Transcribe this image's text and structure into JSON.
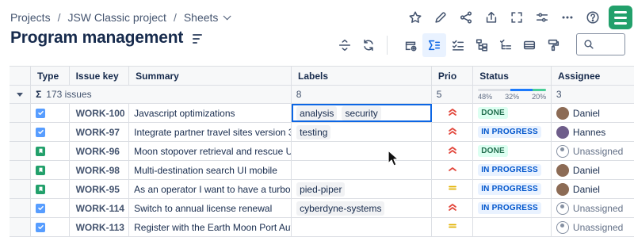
{
  "breadcrumb": {
    "items": [
      "Projects",
      "JSW Classic project",
      "Sheets"
    ],
    "separator": "/"
  },
  "page": {
    "title": "Program management"
  },
  "top_actions": [
    "star-icon",
    "edit-icon",
    "share-icon",
    "export-icon",
    "fullscreen-icon",
    "filter-settings-icon",
    "more-icon",
    "help-icon"
  ],
  "toolbar": [
    "expand-rows-icon",
    "refresh-icon",
    "add-view-icon",
    "sum-icon",
    "checklist-icon",
    "hierarchy-icon",
    "hierarchy-check-icon",
    "card-icon",
    "format-paint-icon"
  ],
  "search": {
    "placeholder": ""
  },
  "table": {
    "columns": [
      "Type",
      "Issue key",
      "Summary",
      "Labels",
      "Prio",
      "Status",
      "Assignee"
    ],
    "summary": {
      "issues": "173 issues",
      "labels": "8",
      "prio": "5",
      "status_segments": [
        {
          "label": "48%",
          "value": 48,
          "color": "#dcdfe4"
        },
        {
          "label": "32%",
          "value": 32,
          "color": "#1d7afc"
        },
        {
          "label": "20%",
          "value": 20,
          "color": "#4bce97"
        }
      ],
      "assignee": "3"
    },
    "rows": [
      {
        "type": "task",
        "key": "WORK-100",
        "summary": "Javascript optimizations",
        "labels": [
          "analysis",
          "security"
        ],
        "prio": "highest",
        "status": "DONE",
        "status_kind": "done",
        "assignee": "Daniel",
        "avatar": "person"
      },
      {
        "type": "task",
        "key": "WORK-97",
        "summary": "Integrate partner travel sites version 3",
        "labels": [
          "testing"
        ],
        "prio": "highest",
        "status": "IN PROGRESS",
        "status_kind": "prog",
        "assignee": "Hannes",
        "avatar": "person2"
      },
      {
        "type": "story",
        "key": "WORK-96",
        "summary": "Moon stopover retrieval and rescue UI mobile",
        "labels": [],
        "prio": "highest",
        "status": "DONE",
        "status_kind": "done",
        "assignee": "Unassigned",
        "avatar": "unassigned"
      },
      {
        "type": "story",
        "key": "WORK-98",
        "summary": "Multi-destination search UI mobile",
        "labels": [],
        "prio": "high",
        "status": "IN PROGRESS",
        "status_kind": "prog",
        "assignee": "Daniel",
        "avatar": "person"
      },
      {
        "type": "story",
        "key": "WORK-95",
        "summary": "As an operator I want to have a turbo boost",
        "labels": [
          "pied-piper"
        ],
        "prio": "medium",
        "status": "IN PROGRESS",
        "status_kind": "prog",
        "assignee": "Daniel",
        "avatar": "person"
      },
      {
        "type": "task",
        "key": "WORK-114",
        "summary": "Switch to annual license renewal",
        "labels": [
          "cyberdyne-systems"
        ],
        "prio": "highest",
        "status": "IN PROGRESS",
        "status_kind": "prog",
        "assignee": "Unassigned",
        "avatar": "unassigned"
      },
      {
        "type": "task",
        "key": "WORK-113",
        "summary": "Register with the Earth Moon Port Authority",
        "labels": [],
        "prio": "medium",
        "status": "",
        "status_kind": "",
        "assignee": "Unassigned",
        "avatar": "unassigned"
      }
    ]
  },
  "colors": {
    "accent": "#0c66e4",
    "done_text": "#216e4e",
    "progress_text": "#0055cc",
    "priority_high": "#e2483d",
    "priority_medium": "#e2b203",
    "logo": "#22a06b"
  }
}
